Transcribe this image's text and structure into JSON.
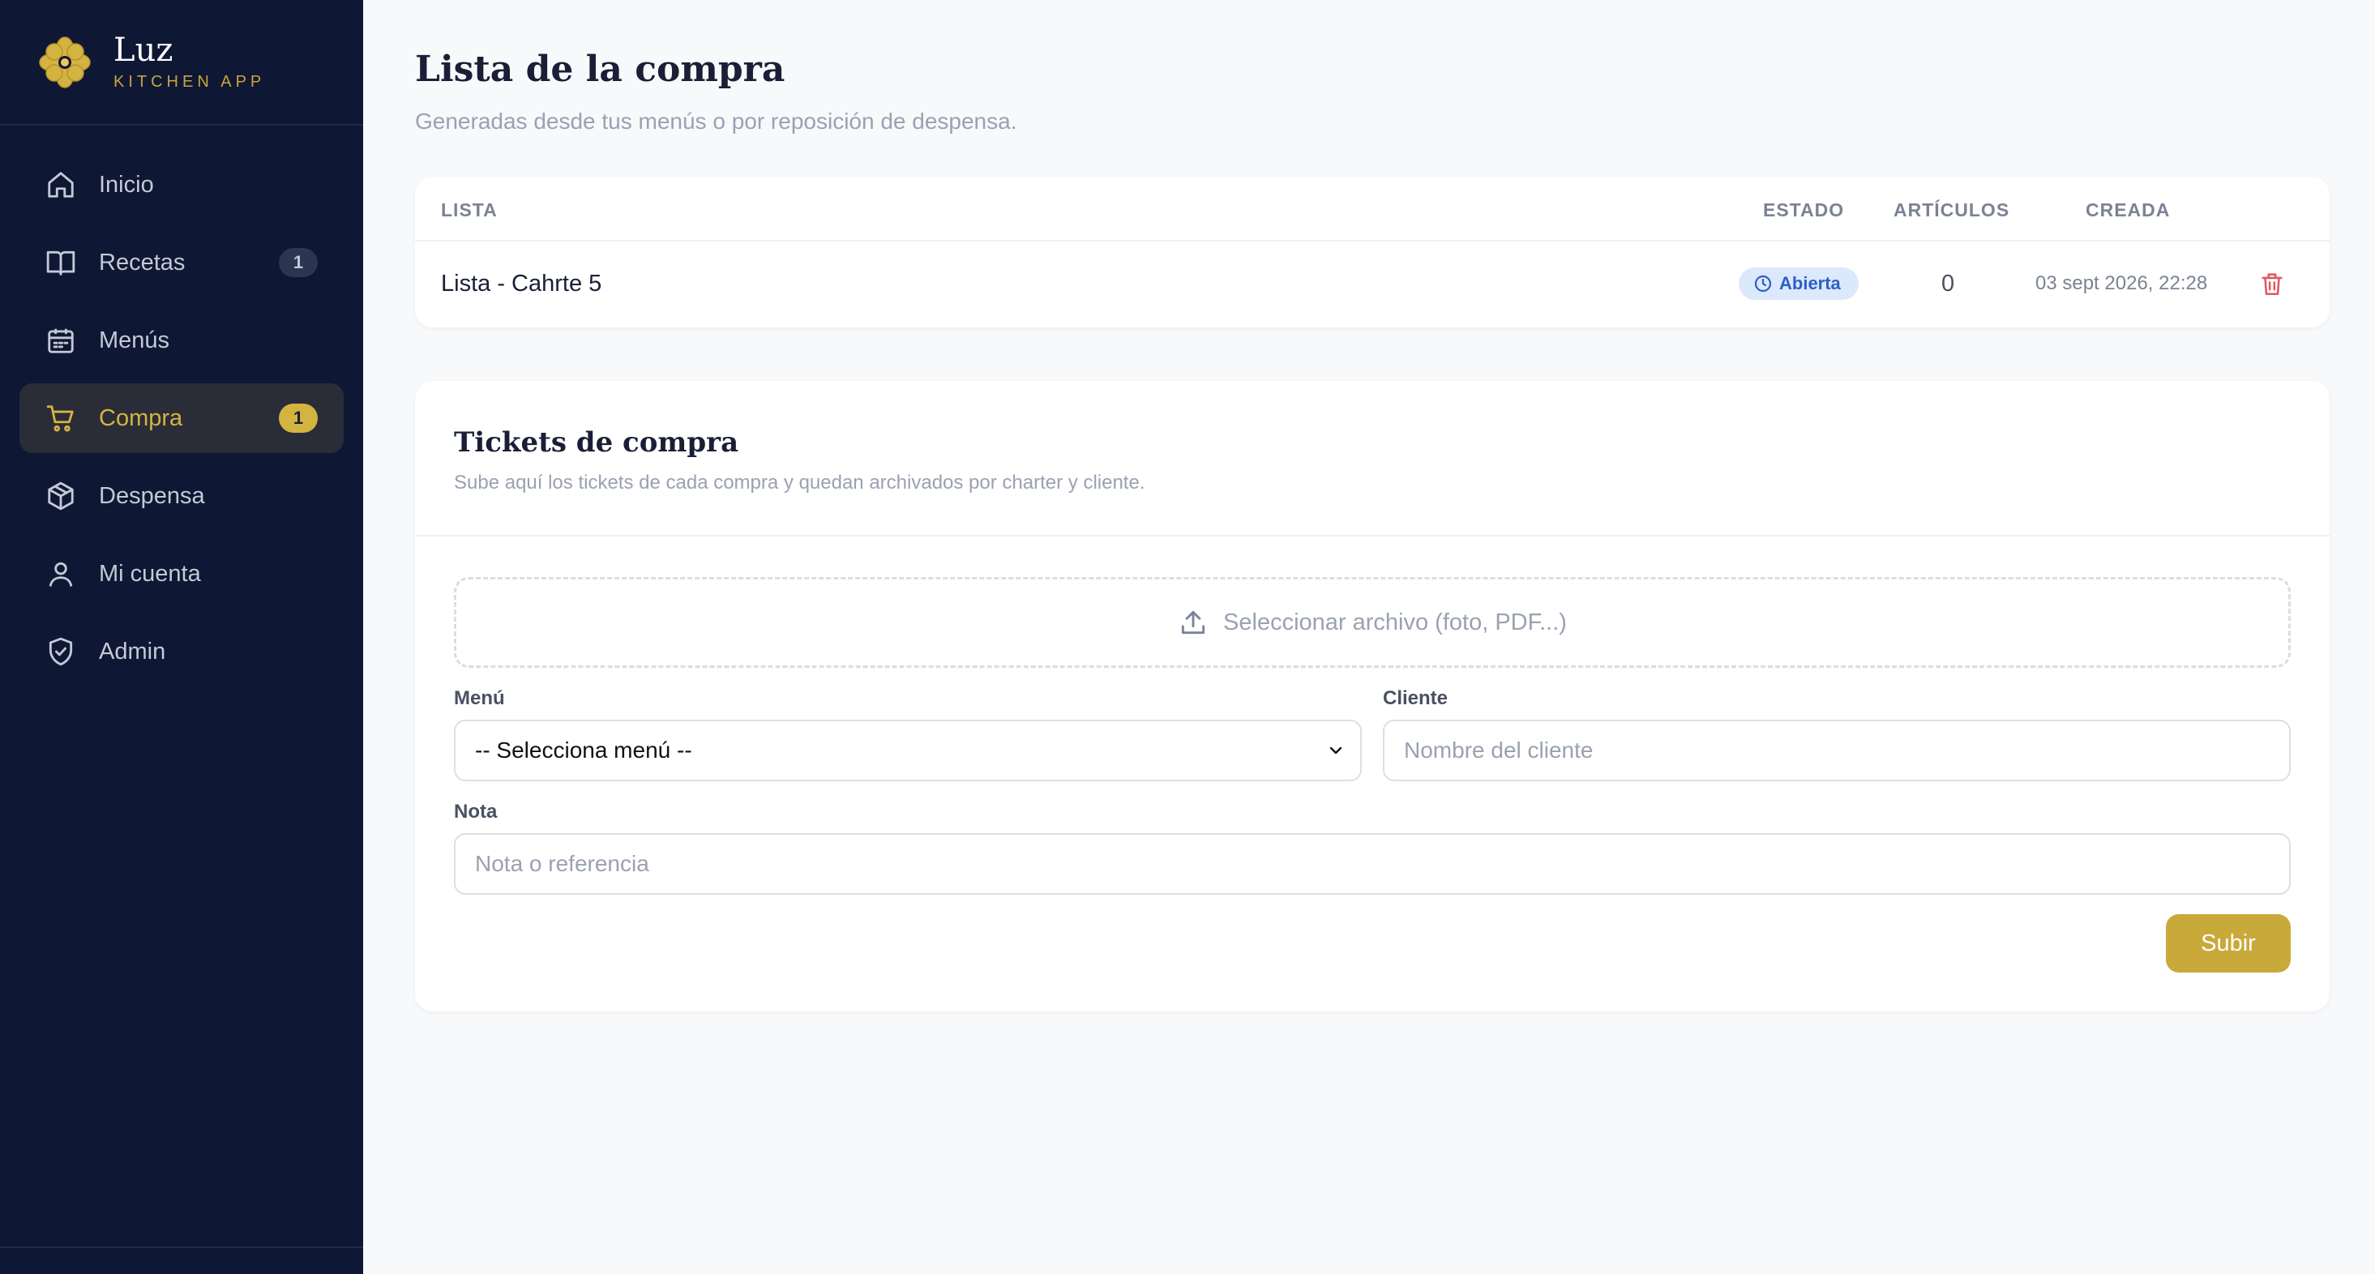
{
  "brand": {
    "name": "Luz",
    "subtitle": "KITCHEN APP"
  },
  "sidebar": {
    "items": [
      {
        "label": "Inicio",
        "icon": "home-icon"
      },
      {
        "label": "Recetas",
        "icon": "book-icon",
        "badge": "1"
      },
      {
        "label": "Menús",
        "icon": "calendar-icon"
      },
      {
        "label": "Compra",
        "icon": "cart-icon",
        "badge": "1",
        "active": true
      },
      {
        "label": "Despensa",
        "icon": "box-icon"
      },
      {
        "label": "Mi cuenta",
        "icon": "user-icon"
      },
      {
        "label": "Admin",
        "icon": "shield-icon"
      }
    ]
  },
  "page": {
    "title": "Lista de la compra",
    "subtitle": "Generadas desde tus menús o por reposición de despensa."
  },
  "lists_table": {
    "headers": {
      "list": "LISTA",
      "status": "ESTADO",
      "items": "ARTÍCULOS",
      "created": "CREADA"
    },
    "rows": [
      {
        "name": "Lista - Cahrte 5",
        "status": "Abierta",
        "items": "0",
        "created": "03 sept 2026, 22:28"
      }
    ]
  },
  "tickets": {
    "title": "Tickets de compra",
    "description": "Sube aquí los tickets de cada compra y quedan archivados por charter y cliente.",
    "file_select_label": "Seleccionar archivo (foto, PDF...)",
    "menu_label": "Menú",
    "menu_selected": "-- Selecciona menú --",
    "client_label": "Cliente",
    "client_placeholder": "Nombre del cliente",
    "note_label": "Nota",
    "note_placeholder": "Nota o referencia",
    "submit_label": "Subir"
  },
  "colors": {
    "sidebar_bg": "#0e1733",
    "accent_gold": "#c9a93a",
    "status_blue": "#2b5fc8",
    "delete_red": "#e05a5a"
  }
}
